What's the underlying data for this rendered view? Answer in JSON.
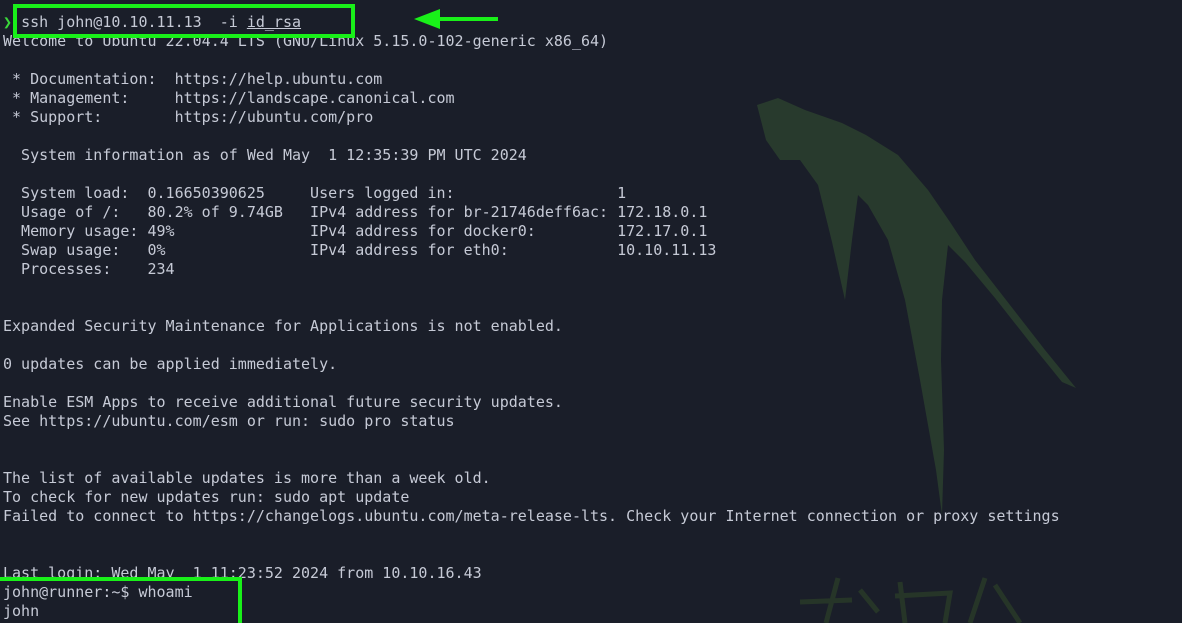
{
  "colors": {
    "background": "#1a1e29",
    "foreground": "#c6cad6",
    "highlight": "#19f019",
    "prompt_arrow": "#3ad93a",
    "watermark": "#2a3d2e"
  },
  "icons": {
    "prompt": "chevron-right-icon",
    "annotation": "arrow-left-icon",
    "watermark": "dragon-logo"
  },
  "terminal": {
    "command_line": {
      "prompt_symbol": "❯",
      "command": "ssh john@10.10.11.13  -i ",
      "key_file": "id_rsa"
    },
    "welcome": "Welcome to Ubuntu 22.04.4 LTS (GNU/Linux 5.15.0-102-generic x86_64)",
    "links": [
      " * Documentation:  https://help.ubuntu.com",
      " * Management:     https://landscape.canonical.com",
      " * Support:        https://ubuntu.com/pro"
    ],
    "sysinfo_header": "  System information as of Wed May  1 12:35:39 PM UTC 2024",
    "sysinfo": [
      "  System load:  0.16650390625     Users logged in:                  1",
      "  Usage of /:   80.2% of 9.74GB   IPv4 address for br-21746deff6ac: 172.18.0.1",
      "  Memory usage: 49%               IPv4 address for docker0:         172.17.0.1",
      "  Swap usage:   0%                IPv4 address for eth0:            10.10.11.13",
      "  Processes:    234"
    ],
    "esm_notice": "Expanded Security Maintenance for Applications is not enabled.",
    "updates_count": "0 updates can be applied immediately.",
    "esm_enable": "Enable ESM Apps to receive additional future security updates.",
    "esm_see": "See https://ubuntu.com/esm or run: sudo pro status",
    "updates_old": "The list of available updates is more than a week old.",
    "updates_check": "To check for new updates run: sudo apt update",
    "connect_failed": "Failed to connect to https://changelogs.ubuntu.com/meta-release-lts. Check your Internet connection or proxy settings",
    "last_login": "Last login: Wed May  1 11:23:52 2024 from 10.10.16.43",
    "shell_prompt": "john@runner:~$ whoami",
    "whoami_output": "john"
  }
}
